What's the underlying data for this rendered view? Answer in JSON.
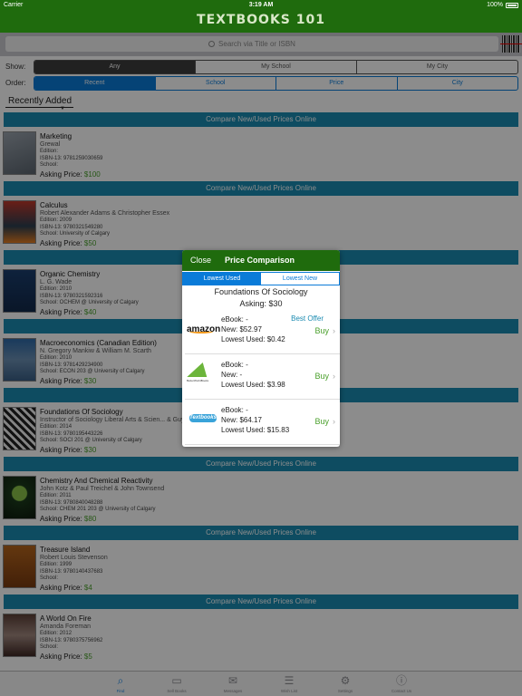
{
  "status": {
    "carrier": "Carrier",
    "time": "3:19 AM",
    "battery": "100%"
  },
  "app_title": "TEXTBOOKS 101",
  "search": {
    "placeholder": "Search via Title or ISBN"
  },
  "show": {
    "label": "Show:",
    "options": [
      "Any",
      "My School",
      "My City"
    ],
    "selected": "Any"
  },
  "order": {
    "label": "Order:",
    "options": [
      "Recent",
      "School",
      "Price",
      "City"
    ],
    "selected": "Recent"
  },
  "section_title": "Recently Added",
  "compare_label": "Compare New/Used Prices Online",
  "books": [
    {
      "title": "Marketing",
      "author": "Grewal",
      "edition": "Edition:",
      "isbn": "ISBN-13: 9781259030659",
      "school": "School:",
      "asking_label": "Asking Price:",
      "price": "$100"
    },
    {
      "title": "Calculus",
      "author": "Robert Alexander Adams & Christopher Essex",
      "edition": "Edition: 2009",
      "isbn": "ISBN-13: 9780321549280",
      "school": "School: University of Calgary",
      "asking_label": "Asking Price:",
      "price": "$50"
    },
    {
      "title": "Organic Chemistry",
      "author": "L. G. Wade",
      "edition": "Edition: 2010",
      "isbn": "ISBN-13: 9780321592316",
      "school": "School: OCHEM @ University of Calgary",
      "asking_label": "Asking Price:",
      "price": "$40"
    },
    {
      "title": "Macroeconomics (Canadian Edition)",
      "author": "N. Gregory Mankiw & William M. Scarth",
      "edition": "Edition: 2010",
      "isbn": "ISBN-13: 9781429234900",
      "school": "School: ECON 203 @ University of Calgary",
      "asking_label": "Asking Price:",
      "price": "$30"
    },
    {
      "title": "Foundations Of Sociology",
      "author": "Instructor of Sociology Liberal Arts & Scien... & Guy Kirby Letts",
      "edition": "Edition: 2014",
      "isbn": "ISBN-13: 9780195443226",
      "school": "School: SOCI 201 @ University of Calgary",
      "asking_label": "Asking Price:",
      "price": "$30"
    },
    {
      "title": "Chemistry And Chemical Reactivity",
      "author": "John Kotz & Paul Treichel & John Townsend",
      "edition": "Edition: 2011",
      "isbn": "ISBN-13: 9780840048288",
      "school": "School: CHEM 201 203 @ University of Calgary",
      "asking_label": "Asking Price:",
      "price": "$80"
    },
    {
      "title": "Treasure Island",
      "author": "Robert Louis Stevenson",
      "edition": "Edition: 1999",
      "isbn": "ISBN-13: 9780140437683",
      "school": "School:",
      "asking_label": "Asking Price:",
      "price": "$4"
    },
    {
      "title": "A World On Fire",
      "author": "Amanda Foreman",
      "edition": "Edition: 2012",
      "isbn": "ISBN-13: 9780375756962",
      "school": "School:",
      "asking_label": "Asking Price:",
      "price": "$5"
    }
  ],
  "popup": {
    "close_label": "Close",
    "title": "Price Comparison",
    "tabs": [
      "Lowest Used",
      "Lowest New"
    ],
    "selected_tab": "Lowest Used",
    "book_title": "Foundations Of Sociology",
    "asking": "Asking: $30",
    "offers": [
      {
        "vendor": "amazon",
        "ebook": "eBook:  -",
        "new": "New: $52.97",
        "used": "Lowest Used: $0.42",
        "buy": "Buy",
        "badge": "Best Offer"
      },
      {
        "vendor": "BetterWorldBooks",
        "ebook": "eBook:  -",
        "new": "New:  -",
        "used": "Lowest Used: $3.98",
        "buy": "Buy",
        "badge": ""
      },
      {
        "vendor": "Textbooks",
        "ebook": "eBook:  -",
        "new": "New: $64.17",
        "used": "Lowest Used: $15.83",
        "buy": "Buy",
        "badge": ""
      }
    ]
  },
  "tabs": [
    {
      "label": "Find",
      "icon": "search-icon",
      "active": true
    },
    {
      "label": "Sell Books",
      "icon": "book-icon",
      "active": false
    },
    {
      "label": "Messages",
      "icon": "envelope-icon",
      "active": false
    },
    {
      "label": "Wish List",
      "icon": "list-icon",
      "active": false
    },
    {
      "label": "Settings",
      "icon": "gear-icon",
      "active": false
    },
    {
      "label": "Contact Us",
      "icon": "question-icon",
      "active": false
    }
  ],
  "colors": {
    "header": "#1f6b0d",
    "accent": "#0a7bd8",
    "compare_bar": "#1b8bb1",
    "price": "#4aa02c"
  }
}
